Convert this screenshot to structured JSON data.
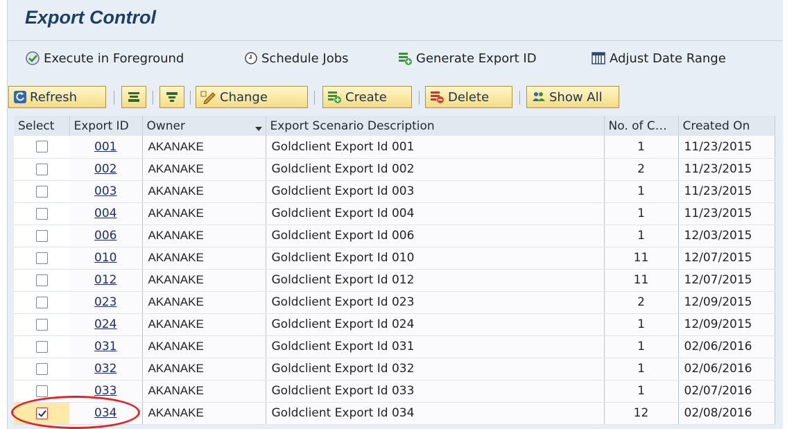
{
  "title": "Export Control",
  "app_toolbar": {
    "execute_foreground": "Execute in Foreground",
    "schedule_jobs": "Schedule Jobs",
    "generate_export_id": "Generate Export ID",
    "adjust_date_range": "Adjust Date Range"
  },
  "grid_toolbar": {
    "refresh": "Refresh",
    "change": "Change",
    "create": "Create",
    "delete": "Delete",
    "show_all": "Show All"
  },
  "table": {
    "headers": [
      "Select",
      "Export ID",
      "Owner",
      "Export Scenario Description",
      "No. of C",
      "Created On"
    ],
    "rows": [
      {
        "id": "001",
        "owner": "AKANAKE",
        "desc": "Goldclient Export Id 001",
        "count": "1",
        "created": "11/23/2015",
        "selected": false
      },
      {
        "id": "002",
        "owner": "AKANAKE",
        "desc": "Goldclient Export Id 002",
        "count": "2",
        "created": "11/23/2015",
        "selected": false
      },
      {
        "id": "003",
        "owner": "AKANAKE",
        "desc": "Goldclient Export Id 003",
        "count": "1",
        "created": "11/23/2015",
        "selected": false
      },
      {
        "id": "004",
        "owner": "AKANAKE",
        "desc": "Goldclient Export Id 004",
        "count": "1",
        "created": "11/23/2015",
        "selected": false
      },
      {
        "id": "006",
        "owner": "AKANAKE",
        "desc": "Goldclient Export Id 006",
        "count": "1",
        "created": "12/03/2015",
        "selected": false
      },
      {
        "id": "010",
        "owner": "AKANAKE",
        "desc": "Goldclient Export Id 010",
        "count": "11",
        "created": "12/07/2015",
        "selected": false
      },
      {
        "id": "012",
        "owner": "AKANAKE",
        "desc": "Goldclient Export Id 012",
        "count": "11",
        "created": "12/07/2015",
        "selected": false
      },
      {
        "id": "023",
        "owner": "AKANAKE",
        "desc": "Goldclient Export Id 023",
        "count": "2",
        "created": "12/09/2015",
        "selected": false
      },
      {
        "id": "024",
        "owner": "AKANAKE",
        "desc": "Goldclient Export Id 024",
        "count": "1",
        "created": "12/09/2015",
        "selected": false
      },
      {
        "id": "031",
        "owner": "AKANAKE",
        "desc": "Goldclient Export Id 031",
        "count": "1",
        "created": "02/06/2016",
        "selected": false
      },
      {
        "id": "032",
        "owner": "AKANAKE",
        "desc": "Goldclient Export Id 032",
        "count": "1",
        "created": "02/06/2016",
        "selected": false
      },
      {
        "id": "033",
        "owner": "AKANAKE",
        "desc": "Goldclient Export Id 033",
        "count": "1",
        "created": "02/07/2016",
        "selected": false
      },
      {
        "id": "034",
        "owner": "AKANAKE",
        "desc": "Goldclient Export Id 034",
        "count": "12",
        "created": "02/08/2016",
        "selected": true
      }
    ]
  },
  "colors": {
    "title": "#1b3f66",
    "background": "#e7eef5",
    "button_fill": "#f5dc84",
    "highlight_circle": "#e42222"
  }
}
